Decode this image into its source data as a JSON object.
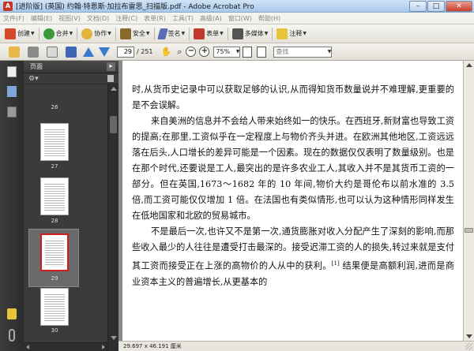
{
  "window": {
    "title": "[进阶版] (英国) 约翰·特恩斯·加拉布雷思_扫描版.pdf - Adobe Acrobat Pro",
    "minimize": "–",
    "maximize": "□",
    "close": "✕"
  },
  "menu": [
    "文件(F)",
    "编辑(E)",
    "视图(V)",
    "文档(D)",
    "注释(C)",
    "表单(R)",
    "工具(T)",
    "高级(A)",
    "窗口(W)",
    "帮助(H)"
  ],
  "toolbar": {
    "create": "创建",
    "combine": "合并",
    "collaborate": "协作",
    "secure": "安全",
    "sign": "签名",
    "forms": "表单",
    "multimedia": "多媒体",
    "comment": "注释"
  },
  "nav": {
    "current_page": "29",
    "total_pages": "/ 251",
    "zoom": "75%",
    "search_placeholder": "查找"
  },
  "pages_panel": {
    "title": "页面",
    "thumbnails": [
      {
        "label": "26"
      },
      {
        "label": "27"
      },
      {
        "label": "28"
      },
      {
        "label": "29",
        "selected": true
      },
      {
        "label": "30"
      }
    ]
  },
  "document": {
    "paragraphs": [
      {
        "indent": false,
        "text": "时,从货币史记录中可以获取足够的认识,从而得知货币数量说并不难理解,更重要的是不会误解。"
      },
      {
        "indent": true,
        "text": "来自美洲的信息并不会给人带来始终如一的快乐。在西班牙,新财富也导致工资的提高;在那里,工资似乎在一定程度上与物价齐头并进。在欧洲其他地区,工资远远落在后头,人口增长的差异可能是一个因素。现在的数据仅仅表明了数量级别。也是在那个时代,还要说是工人,最突出的是许多农业工人,其收入并不是其货币工资的一部分。但在英国,1673～1682 年的 10 年间,物价大约是哥伦布以前水准的 3.5 倍,而工资可能仅仅增加 1 倍。在法国也有类似情形,也可以认为这种情形同样发生在低地国家和北欧的贸易城市。"
      },
      {
        "indent": true,
        "text": "不是最后一次,也许又不是第一次,通货膨胀对收入分配产生了深刻的影响,而那些收入最少的人往往是遭受打击最深的。接受迟滞工资的人的损失,转过来就是支付其工资而接受正在上涨的高物价的人从中的获利。",
        "note": "[1]",
        "tail": " 结果便是高额利润,进而是商业资本主义的普遍增长,从更基本的"
      }
    ]
  },
  "status": {
    "dimensions": "29.697 x 46.191 厘米"
  }
}
